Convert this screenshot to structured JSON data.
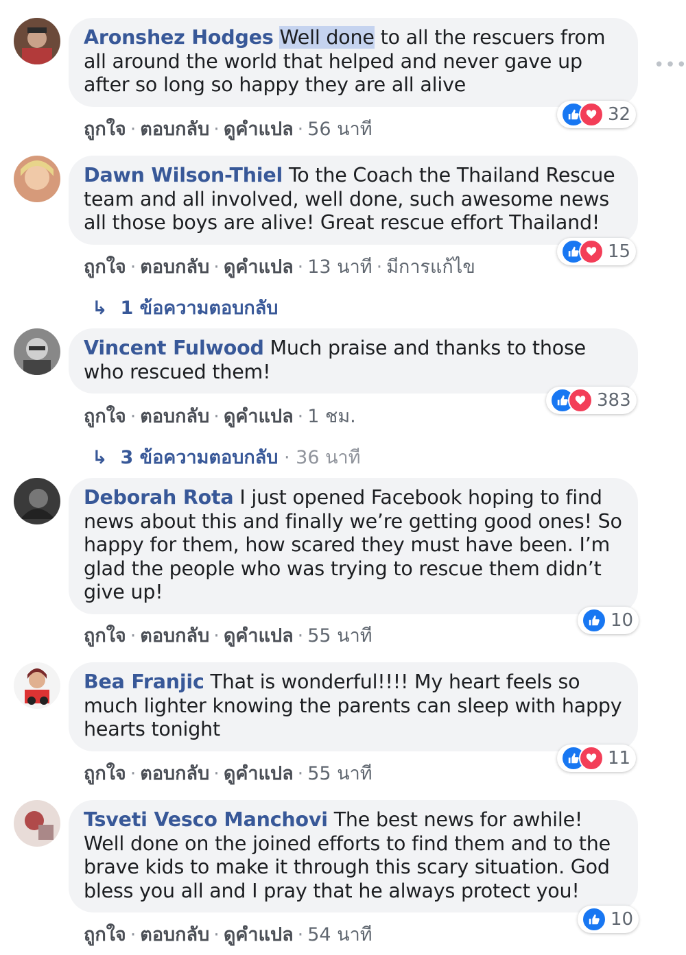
{
  "comments": [
    {
      "author": "Aronshez Hodges",
      "text_highlight": "Well done",
      "text": " to all the rescuers from all around the world that helped and never gave up after so long so happy they are all alive",
      "like": "ถูกใจ",
      "reply": "ตอบกลับ",
      "translate": "ดูคำแปล",
      "time": "56 นาที",
      "reaction_count": "32"
    },
    {
      "author": "Dawn Wilson-Thiel",
      "text": "To the Coach the Thailand Rescue team and all involved, well done, such awesome news all those boys are alive! Great rescue effort Thailand!",
      "like": "ถูกใจ",
      "reply": "ตอบกลับ",
      "translate": "ดูคำแปล",
      "time": "13 นาที",
      "edited": "มีการแก้ไข",
      "reaction_count": "15",
      "replies_label": "1 ข้อความตอบกลับ"
    },
    {
      "author": "Vincent Fulwood",
      "text": "Much praise and thanks to those who rescued them!",
      "like": "ถูกใจ",
      "reply": "ตอบกลับ",
      "translate": "ดูคำแปล",
      "time": "1 ชม.",
      "reaction_count": "383",
      "replies_label": "3 ข้อความตอบกลับ",
      "replies_time": "36 นาที"
    },
    {
      "author": "Deborah Rota",
      "text": "I just opened Facebook hoping to find news about this and finally we’re getting good ones! So happy for them, how scared they must have been. I’m glad the people who was trying to rescue them didn’t give up!",
      "like": "ถูกใจ",
      "reply": "ตอบกลับ",
      "translate": "ดูคำแปล",
      "time": "55 นาที",
      "reaction_count": "10"
    },
    {
      "author": "Bea Franjic",
      "text": "That is wonderful!!!! My heart feels so much lighter knowing the parents can sleep with happy hearts tonight",
      "like": "ถูกใจ",
      "reply": "ตอบกลับ",
      "translate": "ดูคำแปล",
      "time": "55 นาที",
      "reaction_count": "11"
    },
    {
      "author": "Tsveti Vesco Manchovi",
      "text": "The best news for awhile! Well done on the joined efforts to find them and to the brave kids to make it through this scary situation. God bless you all and I pray that he always protect you!",
      "like": "ถูกใจ",
      "reply": "ตอบกลับ",
      "translate": "ดูคำแปล",
      "time": "54 นาที",
      "reaction_count": "10"
    }
  ],
  "more_icon": "ellipsis-icon",
  "colors": {
    "author": "#385898",
    "bubble": "#f2f3f5",
    "like": "#1877f2",
    "love": "#f33e58"
  }
}
